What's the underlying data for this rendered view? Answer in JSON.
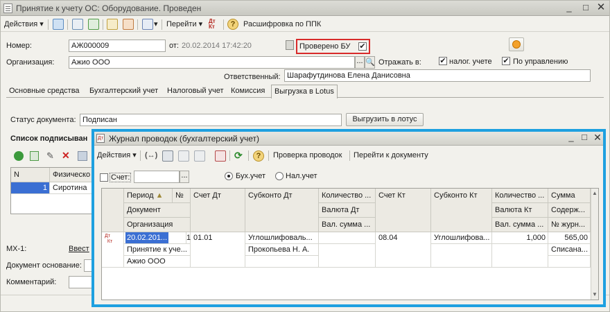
{
  "window": {
    "title": "Принятие к учету ОС: Оборудование. Проведен"
  },
  "toolbar": {
    "actions_label": "Действия",
    "goto_label": "Перейти",
    "decoding_label": "Расшифровка по ППК",
    "dtkt_icon_text": "Дт Кт"
  },
  "form": {
    "number_label": "Номер:",
    "number_value": "АЖ000009",
    "date_label": "от:",
    "date_value": "20.02.2014 17:42:20",
    "checked_bu_label": "Проверено БУ",
    "org_label": "Организация:",
    "org_value": "Ажио ООО",
    "reflect_label": "Отражать в:",
    "tax_label": "налог. учете",
    "mgmt_label": "По управлению",
    "responsible_label": "Ответственный:",
    "responsible_value": "Шарафутдинова Елена Данисовна"
  },
  "tabs": [
    "Основные средства",
    "Бухгалтерский учет",
    "Налоговый учет",
    "Комиссия",
    "Выгрузка в Lotus"
  ],
  "lotus": {
    "status_label": "Статус документа:",
    "status_value": "Подписан",
    "upload_button": "Выгрузить в лотус",
    "signers_title": "Список подписыван",
    "col_n": "N",
    "col_person": "Физическо",
    "row_n": "1",
    "row_person": "Сиротина"
  },
  "bottom": {
    "mx_label": "МХ-1:",
    "mx_link": "Ввест",
    "basis_label": "Документ основание:",
    "comment_label": "Комментарий:"
  },
  "journal": {
    "title": "Журнал проводок (бухгалтерский учет)",
    "actions_label": "Действия",
    "check_button": "Проверка проводок",
    "goto_doc_button": "Перейти к документу",
    "account_label": "Счет:",
    "radio_bu": "Бух.учет",
    "radio_nu": "Нал.учет",
    "headers": {
      "period": "Период",
      "num": "№",
      "document": "Документ",
      "organization": "Организация",
      "debit": "Счет Дт",
      "subconto_dt": "Субконто Дт",
      "qty_dt": "Количество ...",
      "currency_dt": "Валюта Дт",
      "cur_sum_dt": "Вал. сумма ...",
      "credit": "Счет Кт",
      "subconto_kt": "Субконто Кт",
      "qty_kt": "Количество ...",
      "currency_kt": "Валюта Кт",
      "cur_sum_kt": "Вал. сумма ...",
      "sum": "Сумма",
      "content": "Содерж...",
      "journal_no": "№ журн..."
    },
    "row": {
      "period": "20.02.201...",
      "num": "1",
      "document": "Принятие к уче...",
      "organization": "Ажио ООО",
      "debit": "01.01",
      "subconto_dt_1": "Углошлифоваль...",
      "subconto_dt_2": "Прокопьева Н. А.",
      "credit": "08.04",
      "subconto_kt_1": "Углошлифова...",
      "qty_kt": "1,000",
      "sum": "565,00",
      "content": "Списана..."
    }
  }
}
